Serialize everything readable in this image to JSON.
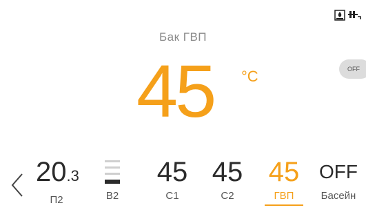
{
  "screen": {
    "title": "Бак ГВП",
    "temperature": "45",
    "unit": "°C",
    "toggle_label": "OFF"
  },
  "zones": [
    {
      "value_main": "20",
      "value_decimal": ".3",
      "label": "П2"
    },
    {
      "value_main": "",
      "label": "В2",
      "icon": "level-bars-icon"
    },
    {
      "value_main": "45",
      "label": "С1"
    },
    {
      "value_main": "45",
      "label": "С2"
    },
    {
      "value_main": "45",
      "label": "ГВП",
      "active": true
    },
    {
      "value_main": "OFF",
      "label": "Басейн"
    }
  ],
  "colors": {
    "accent": "#f5a01a",
    "text": "#2b2b2b",
    "muted": "#8a8a8a"
  },
  "icons": [
    "tank-icon",
    "heat-exchanger-icon",
    "chevron-left-icon"
  ]
}
